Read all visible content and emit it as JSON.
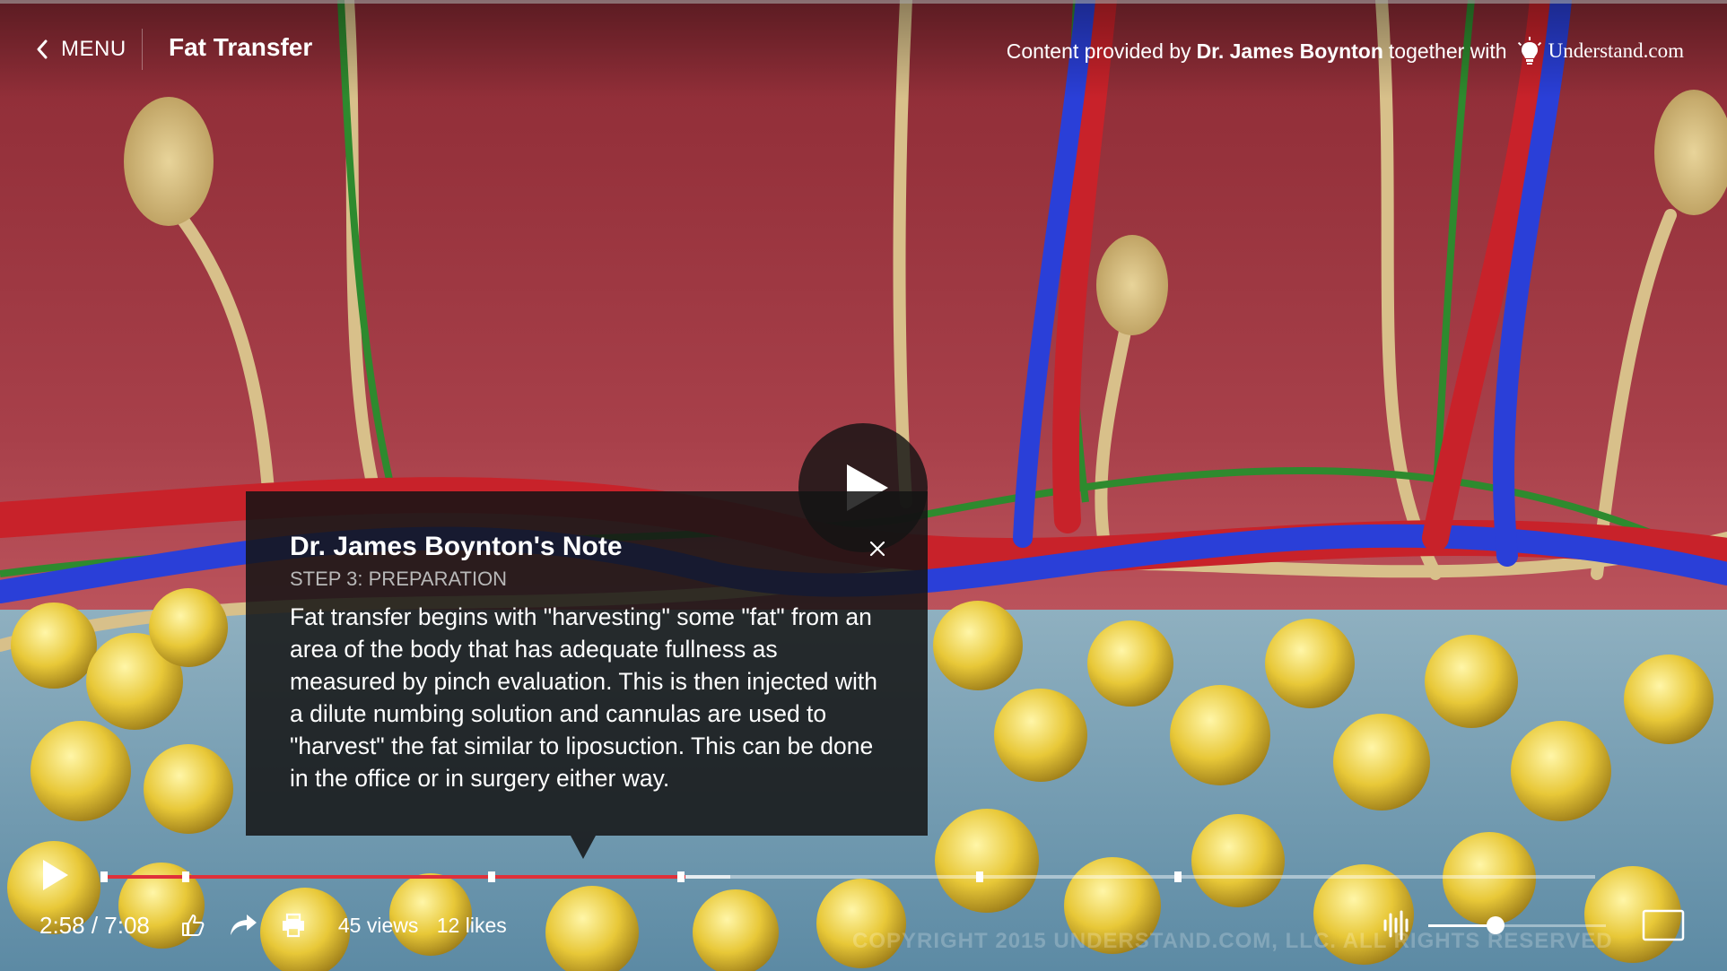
{
  "header": {
    "menu_label": "MENU",
    "title": "Fat Transfer",
    "credit_prefix": "Content provided by",
    "credit_author": "Dr. James Boynton",
    "credit_suffix": "together with",
    "brand": "Understand.com"
  },
  "note": {
    "title": "Dr. James Boynton's Note",
    "step": "STEP 3: PREPARATION",
    "body": "Fat transfer begins with \"harvesting\" some \"fat\" from an area of the body that has adequate fullness as measured by pinch evaluation. This is then injected with a dilute numbing solution and cannulas are used to \"harvest\" the fat similar to liposuction. This can be done in the office or in surgery either way."
  },
  "player": {
    "time_display": "2:58 / 7:08",
    "played_fraction": 0.39,
    "buffered_fraction": 0.42,
    "chapter_marker_fractions": [
      0,
      0.055,
      0.26,
      0.387,
      0.587,
      0.72
    ],
    "views": "45 views",
    "likes": "12 likes",
    "volume_fraction": 0.38,
    "watermark": "COPYRIGHT 2015 UNDERSTAND.COM, LLC. ALL RIGHTS RESERVED"
  },
  "icons": {
    "back": "chevron-left-icon",
    "brand_logo": "lightbulb-icon",
    "big_play": "play-icon",
    "close": "close-icon",
    "play": "play-icon",
    "like": "thumbs-up-icon",
    "share": "share-arrow-icon",
    "print": "printer-icon",
    "volume": "audio-waveform-icon",
    "fullscreen": "fullscreen-icon"
  },
  "colors": {
    "progress_played": "#e0303a",
    "vessel_red": "#c8222a",
    "vessel_blue": "#2a3fd8",
    "nerve_green": "#2e8a2e",
    "fat_cell_yellow": "#e8c838",
    "tissue_red": "#b04048"
  }
}
